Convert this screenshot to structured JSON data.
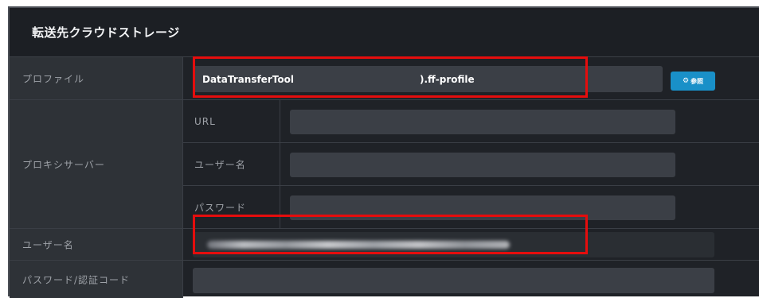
{
  "header": {
    "title": "転送先クラウドストレージ"
  },
  "profile": {
    "label": "プロファイル",
    "value_part1": "DataTransferTool",
    "value_part2": ").ff-profile",
    "browse_icon": "gear-icon",
    "browse_label": "参照"
  },
  "proxy": {
    "label": "プロキシサーバー",
    "url_label": "URL",
    "username_label": "ユーザー名",
    "password_label": "パスワード",
    "url_value": "",
    "username_value": "",
    "password_value": ""
  },
  "username": {
    "label": "ユーザー名",
    "value": ""
  },
  "password_code": {
    "label": "パスワード/認証コード",
    "value": ""
  },
  "colors": {
    "highlight": "#e50d0d",
    "accent": "#1990c8",
    "panel": "#1f2227"
  }
}
